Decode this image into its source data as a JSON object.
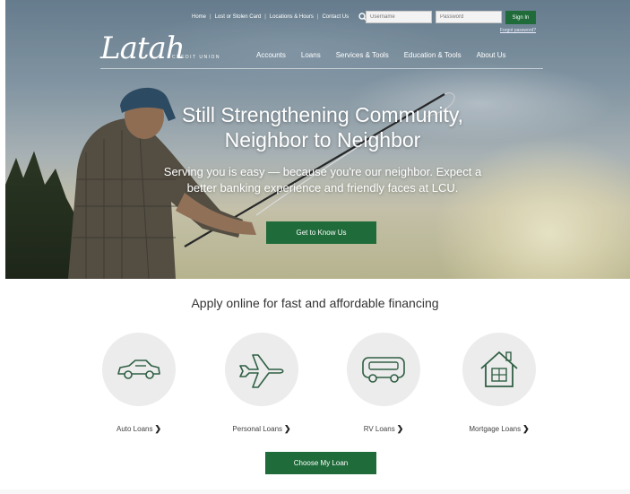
{
  "utility_nav": {
    "links": [
      "Home",
      "Lost or Stolen Card",
      "Locations & Hours",
      "Contact Us"
    ],
    "separator": "|"
  },
  "login": {
    "username_placeholder": "Username",
    "password_placeholder": "Password",
    "signin_label": "Sign In",
    "forgot_label": "Forgot password?"
  },
  "brand": {
    "script": "Latah",
    "subtitle": "CREDIT UNION"
  },
  "main_nav": [
    "Accounts",
    "Loans",
    "Services & Tools",
    "Education & Tools",
    "About Us"
  ],
  "hero": {
    "headline_line1": "Still Strengthening Community,",
    "headline_line2": "Neighbor to Neighbor",
    "subhead_line1": "Serving you is easy — because you're our neighbor. Expect a",
    "subhead_line2": "better banking experience and friendly faces at LCU.",
    "cta_label": "Get to Know Us"
  },
  "apply": {
    "title": "Apply online for fast and affordable financing",
    "loans": [
      {
        "label": "Auto Loans",
        "icon": "car-icon"
      },
      {
        "label": "Personal Loans",
        "icon": "airplane-icon"
      },
      {
        "label": "RV Loans",
        "icon": "bus-icon"
      },
      {
        "label": "Mortgage Loans",
        "icon": "house-icon"
      }
    ],
    "arrow": "❯",
    "cta_label": "Choose My Loan"
  },
  "colors": {
    "brand_green": "#1f6b3a",
    "icon_green": "#2f5f43",
    "circle_gray": "#ececec"
  }
}
